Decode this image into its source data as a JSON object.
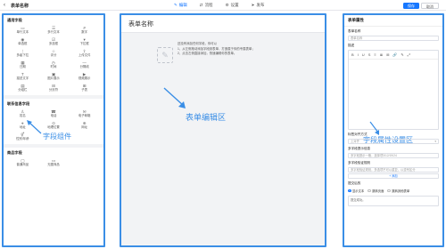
{
  "header": {
    "back_icon": "arrow-left-icon",
    "title": "表单名称",
    "steps": [
      {
        "label": "编辑",
        "icon": "edit-icon",
        "active": true
      },
      {
        "label": "流程",
        "icon": "flow-icon",
        "active": false
      },
      {
        "label": "设置",
        "icon": "gear-icon",
        "active": false
      },
      {
        "label": "发布",
        "icon": "send-icon",
        "active": false
      }
    ],
    "save_label": "保存",
    "cancel_label": "取消"
  },
  "left": {
    "sections": [
      {
        "title": "通用字段",
        "items": [
          {
            "label": "单行文本",
            "icon": "▭"
          },
          {
            "label": "多行文本",
            "icon": "☰"
          },
          {
            "label": "数字",
            "icon": "#"
          },
          {
            "label": "单选框",
            "icon": "◉"
          },
          {
            "label": "多选框",
            "icon": "☑"
          },
          {
            "label": "下拉框",
            "icon": "▾"
          },
          {
            "label": "多级下拉",
            "icon": "⋮"
          },
          {
            "label": "评分",
            "icon": "☆"
          },
          {
            "label": "上传文件",
            "icon": "⇪"
          },
          {
            "label": "日期",
            "icon": "▦"
          },
          {
            "label": "时间",
            "icon": "◷"
          },
          {
            "label": "分隔线",
            "icon": "—"
          },
          {
            "label": "描述文字",
            "icon": "T"
          },
          {
            "label": "图片展示",
            "icon": "▣"
          },
          {
            "label": "视频展示",
            "icon": "▶"
          },
          {
            "label": "分组栏",
            "icon": "▤"
          },
          {
            "label": "分页符",
            "icon": "⊟"
          },
          {
            "label": "子表",
            "icon": "⊞"
          }
        ]
      },
      {
        "title": "联系信息字段",
        "items": [
          {
            "label": "姓名",
            "icon": "♙"
          },
          {
            "label": "电话",
            "icon": "☎"
          },
          {
            "label": "电子邮箱",
            "icon": "✉"
          },
          {
            "label": "地址",
            "icon": "⌖"
          },
          {
            "label": "地理位置",
            "icon": "⊙"
          },
          {
            "label": "网址",
            "icon": "⊕"
          },
          {
            "label": "性别/年龄",
            "icon": "⚥"
          }
        ]
      },
      {
        "title": "商品字段",
        "items": [
          {
            "label": "普通商品",
            "icon": "▢"
          },
          {
            "label": "无图商品",
            "icon": "▭"
          }
        ]
      }
    ],
    "annotation": "字段组件"
  },
  "middle": {
    "title": "表单名称",
    "hint_lines": [
      "还没有添加任何字段，你可以",
      "1、从左侧拖动添加字段到表单，打造属于你的专属表单；",
      "2、点击左侧直接添加，快速编辑你的表单。"
    ],
    "annotation": "表单编辑区"
  },
  "right": {
    "header": "表单属性",
    "form_name_label": "表单名称",
    "form_name_value": "表单名称",
    "desc_label": "描述",
    "toolbar": [
      "B",
      "I",
      "U",
      "S",
      "≡",
      "≣",
      "⊞",
      "🔗",
      "✎",
      "⤢"
    ],
    "annotation": "字段属性设置区",
    "label_align_label": "标签对齐方式",
    "label_align_value": "上对齐",
    "placeholder_label": "多字段提示信息",
    "placeholder_value": "多字段提示一格，选择项3/12/19/24",
    "multi_label": "多字段验证规则",
    "multi_value": "多字段验证规则，多选项不可以重复，以逗号区分",
    "add_label": "+ 添加",
    "submit_label": "提交后的",
    "radios": [
      {
        "label": "显示文本",
        "on": true
      },
      {
        "label": "跳转页面",
        "on": false
      },
      {
        "label": "跳转其他表单",
        "on": false
      }
    ],
    "submit_text": "提交成功。"
  }
}
